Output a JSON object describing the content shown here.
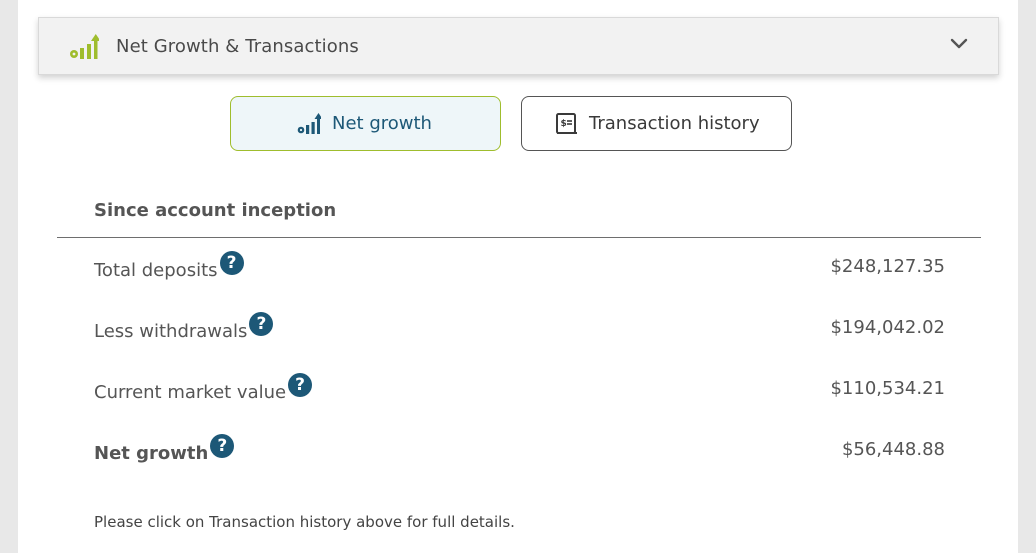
{
  "header": {
    "title": "Net Growth & Transactions",
    "icon": "growth-chart-icon",
    "accent_color": "#9fbd2d"
  },
  "tabs": [
    {
      "label": "Net growth",
      "icon": "growth-chart-icon",
      "active": true
    },
    {
      "label": "Transaction history",
      "icon": "receipt-icon",
      "active": false
    }
  ],
  "section": {
    "title": "Since account inception",
    "rows": [
      {
        "label": "Total deposits",
        "value": "$248,127.35",
        "bold": false
      },
      {
        "label": "Less withdrawals",
        "value": "$194,042.02",
        "bold": false
      },
      {
        "label": "Current market value",
        "value": "$110,534.21",
        "bold": false
      },
      {
        "label": "Net growth",
        "value": "$56,448.88",
        "bold": true
      }
    ],
    "help_glyph": "?"
  },
  "footnote": "Please click on Transaction history above for full details.",
  "colors": {
    "brand_blue": "#1d5877",
    "accent_green": "#9fbd2d",
    "text_gray": "#555555"
  }
}
